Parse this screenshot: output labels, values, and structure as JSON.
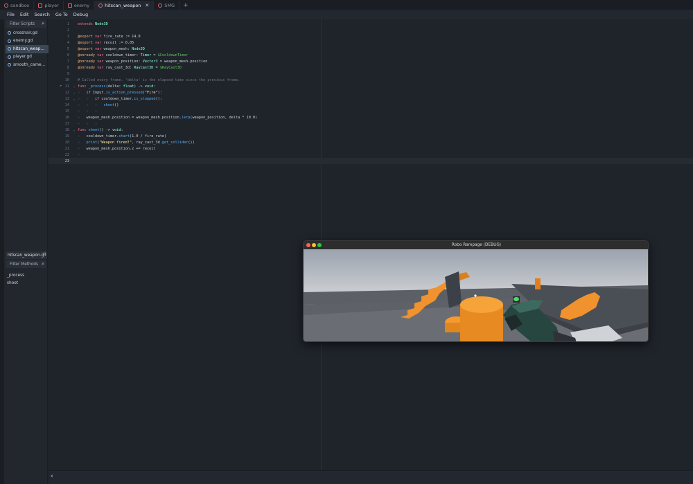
{
  "tabs": [
    {
      "label": "sandbox",
      "active": false,
      "closable": false,
      "icon": "scene-icon"
    },
    {
      "label": "player",
      "active": false,
      "closable": false,
      "icon": "robot-icon"
    },
    {
      "label": "enemy",
      "active": false,
      "closable": false,
      "icon": "robot-icon"
    },
    {
      "label": "hitscan_weapon",
      "active": true,
      "closable": true,
      "icon": "scene-icon"
    },
    {
      "label": "SMG",
      "active": false,
      "closable": false,
      "icon": "scene-icon"
    }
  ],
  "tab_close_glyph": "✕",
  "tab_add_glyph": "+",
  "menu": [
    "File",
    "Edit",
    "Search",
    "Go To",
    "Debug"
  ],
  "sidebar": {
    "filter_scripts_placeholder": "Filter Scripts",
    "scripts": [
      {
        "label": "crosshair.gd",
        "active": false
      },
      {
        "label": "enemy.gd",
        "active": false
      },
      {
        "label": "hitscan_weap...",
        "active": true
      },
      {
        "label": "player.gd",
        "active": false
      },
      {
        "label": "smooth_came...",
        "active": false
      }
    ],
    "current_script": "hitscan_weapon.g",
    "filter_methods_placeholder": "Filter Methods",
    "methods": [
      "_process",
      "shoot"
    ]
  },
  "code_lines": [
    {
      "n": "1",
      "text": "extends Node3D",
      "segments": [
        [
          "extends ",
          "#ff7085"
        ],
        [
          "Node3D",
          "#8fffdb"
        ]
      ]
    },
    {
      "n": "2",
      "segments": []
    },
    {
      "n": "3",
      "segments": [
        [
          "@export ",
          "#ffb373"
        ],
        [
          "var ",
          "#ff7085"
        ],
        [
          "fire_rate := 14.0",
          "#cdd3dc"
        ]
      ]
    },
    {
      "n": "4",
      "segments": [
        [
          "@export ",
          "#ffb373"
        ],
        [
          "var ",
          "#ff7085"
        ],
        [
          "recoil := 0.05",
          "#cdd3dc"
        ]
      ]
    },
    {
      "n": "5",
      "segments": [
        [
          "@export ",
          "#ffb373"
        ],
        [
          "var ",
          "#ff7085"
        ],
        [
          "weapon_mesh: ",
          "#cdd3dc"
        ],
        [
          "Node3D",
          "#8fffdb"
        ]
      ]
    },
    {
      "n": "6",
      "segments": [
        [
          "@onready ",
          "#ffb373"
        ],
        [
          "var ",
          "#ff7085"
        ],
        [
          "cooldown_timer: ",
          "#cdd3dc"
        ],
        [
          "Timer",
          "#8fffdb"
        ],
        [
          " = ",
          "#cdd3dc"
        ],
        [
          "$CooldownTimer",
          "#63c259"
        ]
      ]
    },
    {
      "n": "7",
      "segments": [
        [
          "@onready ",
          "#ffb373"
        ],
        [
          "var ",
          "#ff7085"
        ],
        [
          "weapon_position: ",
          "#cdd3dc"
        ],
        [
          "Vector3",
          "#8fffdb"
        ],
        [
          " = weapon_mesh.position",
          "#cdd3dc"
        ]
      ]
    },
    {
      "n": "8",
      "segments": [
        [
          "@onready ",
          "#ffb373"
        ],
        [
          "var ",
          "#ff7085"
        ],
        [
          "ray_cast_3d: ",
          "#cdd3dc"
        ],
        [
          "RayCast3D",
          "#8fffdb"
        ],
        [
          " = ",
          "#cdd3dc"
        ],
        [
          "$RayCast3D",
          "#63c259"
        ]
      ]
    },
    {
      "n": "9",
      "segments": []
    },
    {
      "n": "10",
      "segments": [
        [
          "# Called every frame. 'delta' is the elapsed time since the previous frame.",
          "#6d7580"
        ]
      ]
    },
    {
      "n": "11",
      "fold": "⌄",
      "icon": "↗",
      "segments": [
        [
          "func ",
          "#ff7085"
        ],
        [
          "_process",
          "#57b3ff"
        ],
        [
          "(delta: ",
          "#cdd3dc"
        ],
        [
          "float",
          "#8fffdb"
        ],
        [
          ") -> ",
          "#cdd3dc"
        ],
        [
          "void",
          "#8fffdb"
        ],
        [
          ":",
          "#cdd3dc"
        ]
      ]
    },
    {
      "n": "12",
      "fold": "⌄",
      "segments": [
        [
          "»   ",
          "#444c57"
        ],
        [
          "if ",
          "#ff8ccc"
        ],
        [
          "Input.",
          "#cdd3dc"
        ],
        [
          "is_action_pressed",
          "#57b3ff"
        ],
        [
          "(",
          "#cdd3dc"
        ],
        [
          "\"Fire\"",
          "#ffeda1"
        ],
        [
          "):",
          "#cdd3dc"
        ]
      ]
    },
    {
      "n": "13",
      "fold": "⌄",
      "segments": [
        [
          "»   »   ",
          "#444c57"
        ],
        [
          "if ",
          "#ff8ccc"
        ],
        [
          "cooldown_timer.",
          "#cdd3dc"
        ],
        [
          "is_stopped",
          "#57b3ff"
        ],
        [
          "():",
          "#cdd3dc"
        ]
      ]
    },
    {
      "n": "14",
      "segments": [
        [
          "»   »   »   ",
          "#444c57"
        ],
        [
          "shoot",
          "#57b3ff"
        ],
        [
          "()",
          "#cdd3dc"
        ]
      ]
    },
    {
      "n": "15",
      "segments": [
        [
          "»   »   »",
          "#444c57"
        ]
      ]
    },
    {
      "n": "16",
      "segments": [
        [
          "»   ",
          "#444c57"
        ],
        [
          "weapon_mesh.position = weapon_mesh.position.",
          "#cdd3dc"
        ],
        [
          "lerp",
          "#57b3ff"
        ],
        [
          "(weapon_position, delta * 10.0)",
          "#cdd3dc"
        ]
      ]
    },
    {
      "n": "17",
      "segments": [
        [
          "»   »   »",
          "#444c57"
        ]
      ]
    },
    {
      "n": "18",
      "fold": "⌄",
      "segments": [
        [
          "func ",
          "#ff7085"
        ],
        [
          "shoot",
          "#57b3ff"
        ],
        [
          "() -> ",
          "#cdd3dc"
        ],
        [
          "void",
          "#8fffdb"
        ],
        [
          ":",
          "#cdd3dc"
        ]
      ]
    },
    {
      "n": "19",
      "segments": [
        [
          "»   ",
          "#444c57"
        ],
        [
          "cooldown_timer.",
          "#cdd3dc"
        ],
        [
          "start",
          "#57b3ff"
        ],
        [
          "(1.0 / fire_rate)",
          "#cdd3dc"
        ]
      ]
    },
    {
      "n": "20",
      "segments": [
        [
          "»   ",
          "#444c57"
        ],
        [
          "print",
          "#57b3ff"
        ],
        [
          "(",
          "#cdd3dc"
        ],
        [
          "\"Weapon fired!\"",
          "#ffeda1"
        ],
        [
          ", ray_cast_3d.",
          "#cdd3dc"
        ],
        [
          "get_collider",
          "#57b3ff"
        ],
        [
          "())",
          "#cdd3dc"
        ]
      ]
    },
    {
      "n": "21",
      "segments": [
        [
          "»   ",
          "#444c57"
        ],
        [
          "weapon_mesh.position.z += recoil",
          "#cdd3dc"
        ]
      ]
    },
    {
      "n": "22",
      "segments": [
        [
          "»",
          "#444c57"
        ]
      ]
    },
    {
      "n": "23",
      "current": true,
      "segments": []
    }
  ],
  "status_chevron": "‹",
  "game_window": {
    "title": "Robo Rampage (DEBUG)",
    "traffic_lights": [
      "#ff5f57",
      "#febc2e",
      "#28c840"
    ]
  },
  "colors": {
    "accent": "#8fb7e8",
    "editor_bg": "#1f242b",
    "orange": "#f0922e",
    "weapon_green": "#2f5d52"
  }
}
